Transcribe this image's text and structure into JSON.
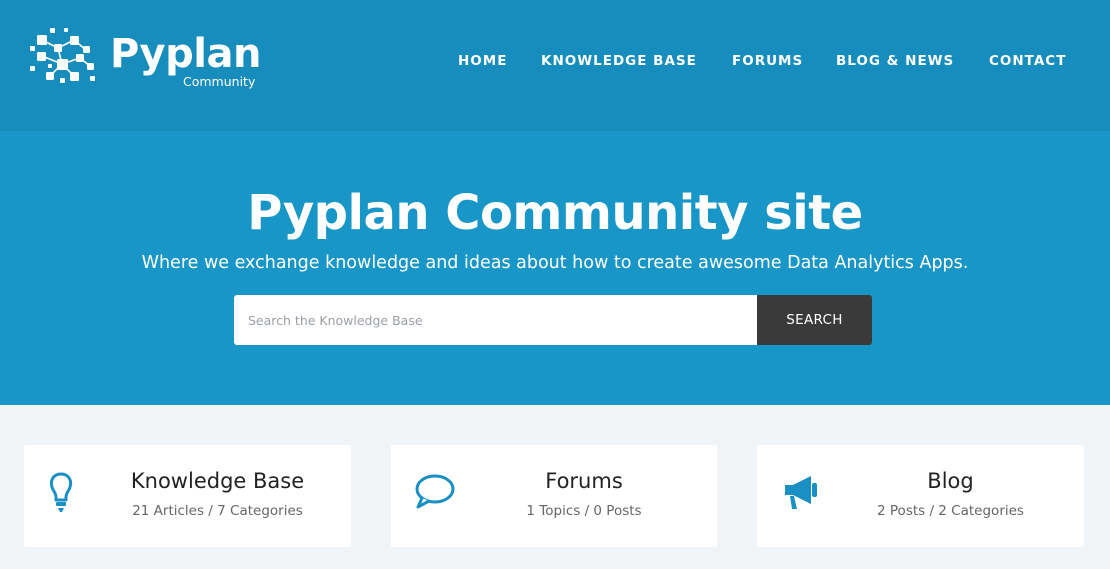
{
  "brand": {
    "name": "Pyplan",
    "tagline": "Community"
  },
  "nav": {
    "items": [
      {
        "label": "HOME"
      },
      {
        "label": "KNOWLEDGE BASE"
      },
      {
        "label": "FORUMS"
      },
      {
        "label": "BLOG & NEWS"
      },
      {
        "label": "CONTACT"
      }
    ]
  },
  "hero": {
    "title": "Pyplan Community site",
    "subtitle": "Where we exchange knowledge and ideas about how to create awesome Data Analytics Apps.",
    "search_placeholder": "Search the Knowledge Base",
    "search_button": "SEARCH"
  },
  "cards": [
    {
      "title": "Knowledge Base",
      "meta": "21 Articles / 7 Categories",
      "icon": "lightbulb-icon"
    },
    {
      "title": "Forums",
      "meta": "1 Topics / 0 Posts",
      "icon": "speech-bubble-icon"
    },
    {
      "title": "Blog",
      "meta": "2 Posts / 2 Categories",
      "icon": "megaphone-icon"
    }
  ],
  "colors": {
    "header": "#168dbd",
    "hero": "#1796c7",
    "accent": "#1a8fc4",
    "search_button": "#3a3a3a",
    "page_bg": "#f1f4f6"
  }
}
